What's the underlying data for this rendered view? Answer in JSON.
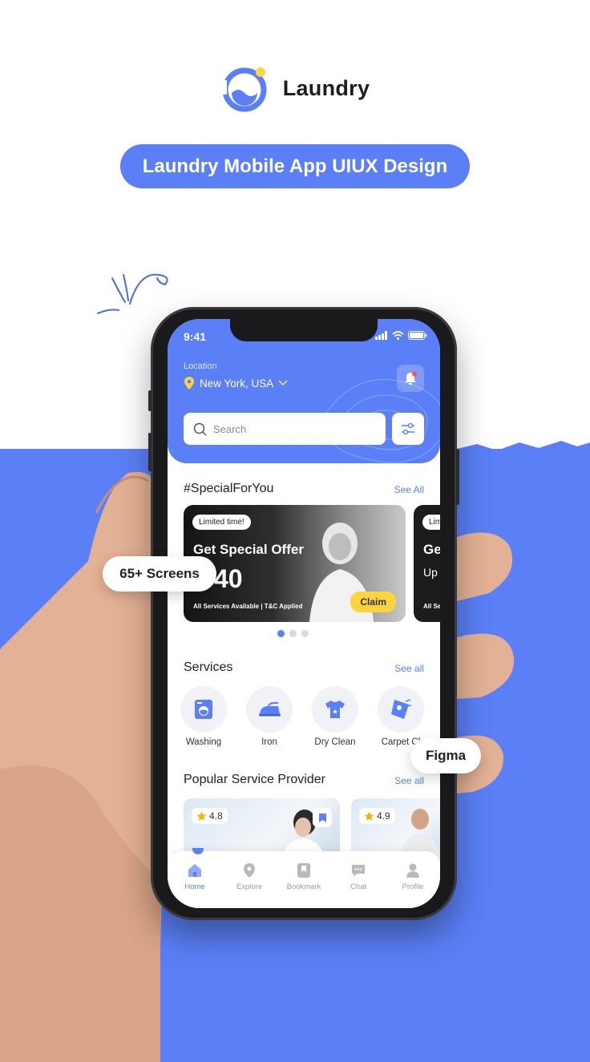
{
  "brand": {
    "name": "Laundry",
    "headline": "Laundry Mobile App UIUX Design"
  },
  "badges": {
    "screens": "65+ Screens",
    "tool": "Figma"
  },
  "colors": {
    "primary": "#5a7ff6",
    "accent": "#ffd23f",
    "white": "#ffffff"
  },
  "status": {
    "time": "9:41"
  },
  "location": {
    "label": "Location",
    "value": "New York, USA"
  },
  "search": {
    "placeholder": "Search"
  },
  "special": {
    "title": "#SpecialForYou",
    "see_all": "See All",
    "cards": [
      {
        "badge": "Limited time!",
        "title": "Get Special Offer",
        "price": "40",
        "note": "All Services Available | T&C Applied",
        "cta": "Claim"
      },
      {
        "badge": "Lim",
        "title": "Ge",
        "subtitle": "Up",
        "note": "All Se"
      }
    ],
    "carousel": {
      "count": 3,
      "active": 0
    }
  },
  "services": {
    "title": "Services",
    "see_all": "See all",
    "items": [
      {
        "label": "Washing",
        "icon": "washing-machine-icon"
      },
      {
        "label": "Iron",
        "icon": "iron-icon"
      },
      {
        "label": "Dry Clean",
        "icon": "tshirt-icon"
      },
      {
        "label": "Carpet Cl",
        "icon": "carpet-icon"
      }
    ]
  },
  "providers": {
    "title": "Popular Service Provider",
    "see_all": "See all",
    "items": [
      {
        "rating": "4.8"
      },
      {
        "rating": "4.9"
      }
    ]
  },
  "nav": {
    "items": [
      {
        "label": "Home",
        "icon": "home-icon",
        "active": true
      },
      {
        "label": "Explore",
        "icon": "location-icon"
      },
      {
        "label": "Bookmark",
        "icon": "bookmark-icon"
      },
      {
        "label": "Chat",
        "icon": "chat-icon"
      },
      {
        "label": "Profile",
        "icon": "profile-icon"
      }
    ]
  }
}
